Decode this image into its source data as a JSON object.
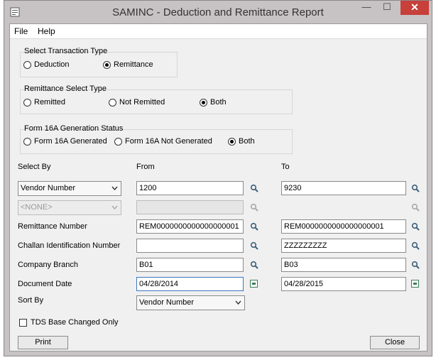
{
  "window": {
    "title": "SAMINC - Deduction and Remittance Report",
    "min_glyph": "—",
    "max_glyph": "☐",
    "close_glyph": "✕"
  },
  "menu": {
    "file": "File",
    "help": "Help"
  },
  "transaction_type": {
    "title": "Select Transaction Type",
    "deduction": "Deduction",
    "remittance": "Remittance",
    "selected": "remittance"
  },
  "remittance_select": {
    "title": "Remittance Select Type",
    "remitted": "Remitted",
    "not_remitted": "Not Remitted",
    "both": "Both",
    "selected": "both"
  },
  "form16a": {
    "title": "Form 16A Generation Status",
    "generated": "Form 16A Generated",
    "not_generated": "Form 16A Not Generated",
    "both": "Both",
    "selected": "both"
  },
  "headers": {
    "select_by": "Select By",
    "from": "From",
    "to": "To"
  },
  "select_by": {
    "value": "Vendor Number",
    "from": "1200",
    "to": "9230"
  },
  "second_select": {
    "value": "<NONE>",
    "from": "",
    "to": ""
  },
  "remittance_number": {
    "label": "Remittance Number",
    "from": "REM0000000000000000001",
    "to": "REM0000000000000000001"
  },
  "challan": {
    "label": "Challan Identification Number",
    "from": "",
    "to": "ZZZZZZZZZ"
  },
  "company_branch": {
    "label": "Company Branch",
    "from": "B01",
    "to": "B03"
  },
  "document_date": {
    "label": "Document Date",
    "from": "04/28/2014",
    "to": "04/28/2015"
  },
  "sort_by": {
    "label": "Sort By",
    "value": "Vendor Number"
  },
  "tds_checkbox": {
    "label": "TDS Base Changed Only",
    "checked": false
  },
  "buttons": {
    "print": "Print",
    "close": "Close"
  }
}
